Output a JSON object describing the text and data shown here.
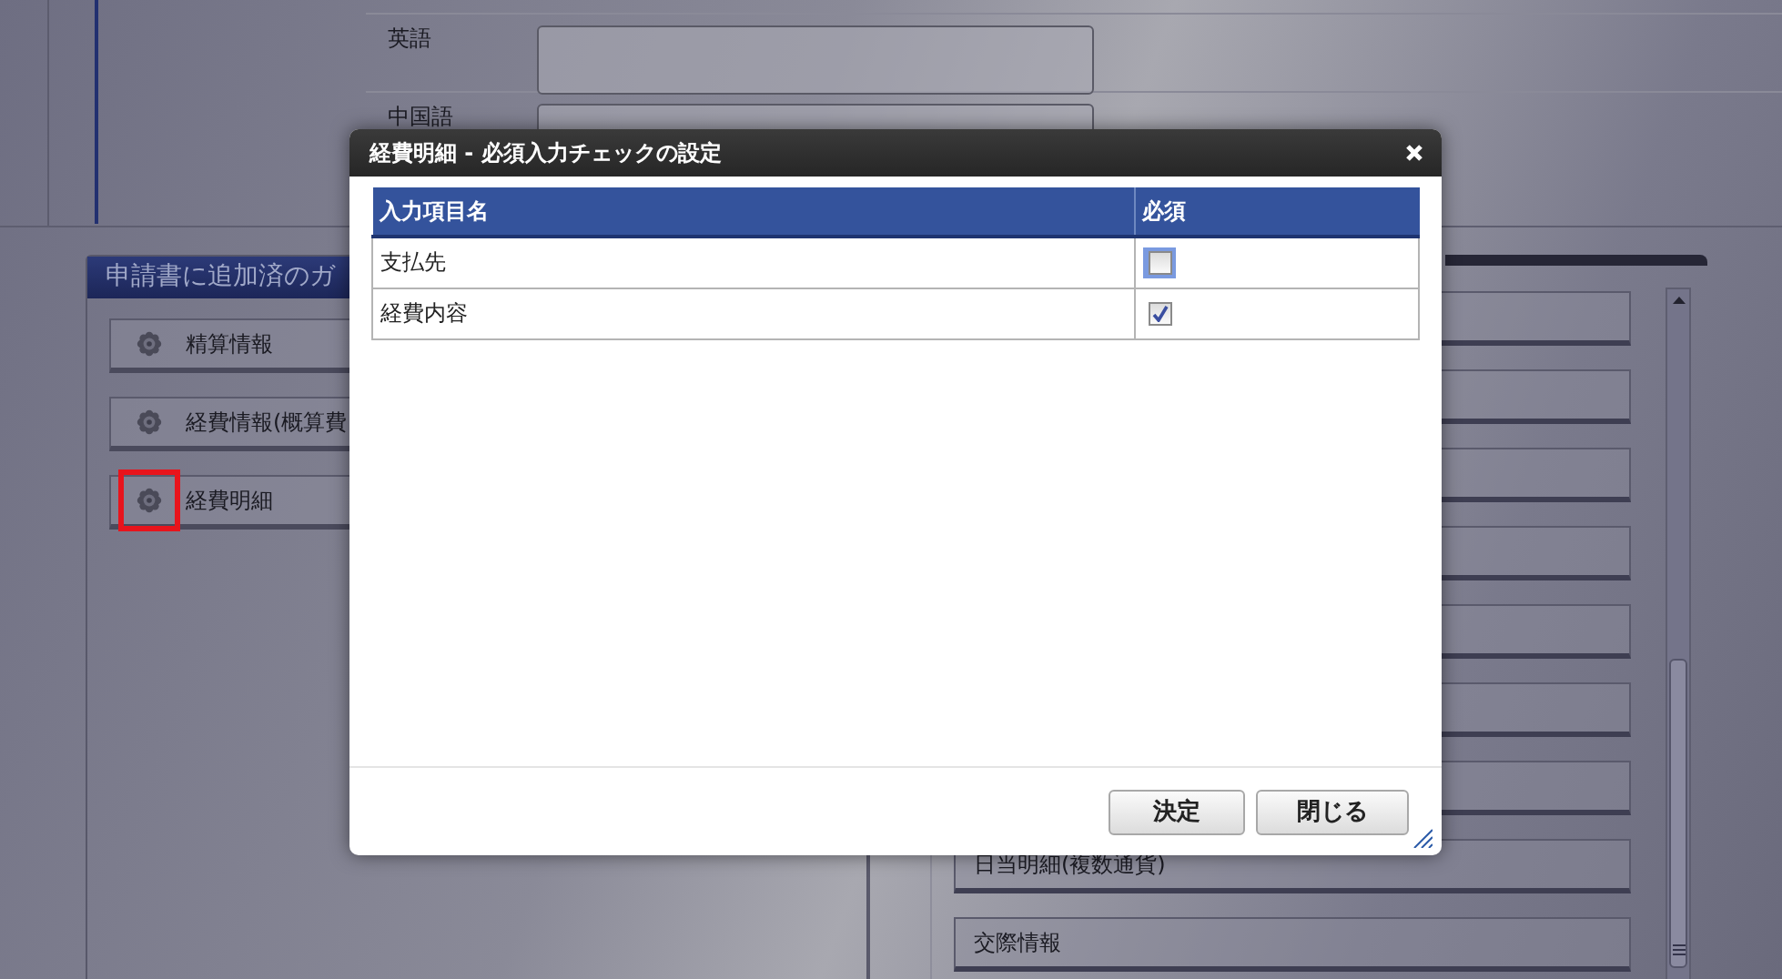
{
  "background": {
    "form_rows": [
      {
        "label": "英語"
      },
      {
        "label": "中国語"
      }
    ],
    "left_panel": {
      "title": "申請書に追加済のガ",
      "items": [
        {
          "label": "精算情報",
          "highlighted": false
        },
        {
          "label": "経費情報(概算費",
          "highlighted": false
        },
        {
          "label": "経費明細",
          "highlighted": true
        }
      ]
    },
    "right_panel": {
      "items": [
        {
          "kind": "blank"
        },
        {
          "kind": "blank"
        },
        {
          "kind": "blank"
        },
        {
          "kind": "blank"
        },
        {
          "kind": "blank"
        },
        {
          "kind": "blank"
        },
        {
          "kind": "blank"
        },
        {
          "kind": "labelled",
          "label": "日当明細(複数通貨)"
        },
        {
          "kind": "labelled",
          "label": "交際情報"
        }
      ]
    }
  },
  "dialog": {
    "title": "経費明細 - 必須入力チェックの設定",
    "columns": [
      "入力項目名",
      "必須"
    ],
    "rows": [
      {
        "name": "支払先",
        "required": false,
        "focused": true
      },
      {
        "name": "経費内容",
        "required": true,
        "focused": false
      }
    ],
    "buttons": [
      "決定",
      "閉じる"
    ]
  }
}
